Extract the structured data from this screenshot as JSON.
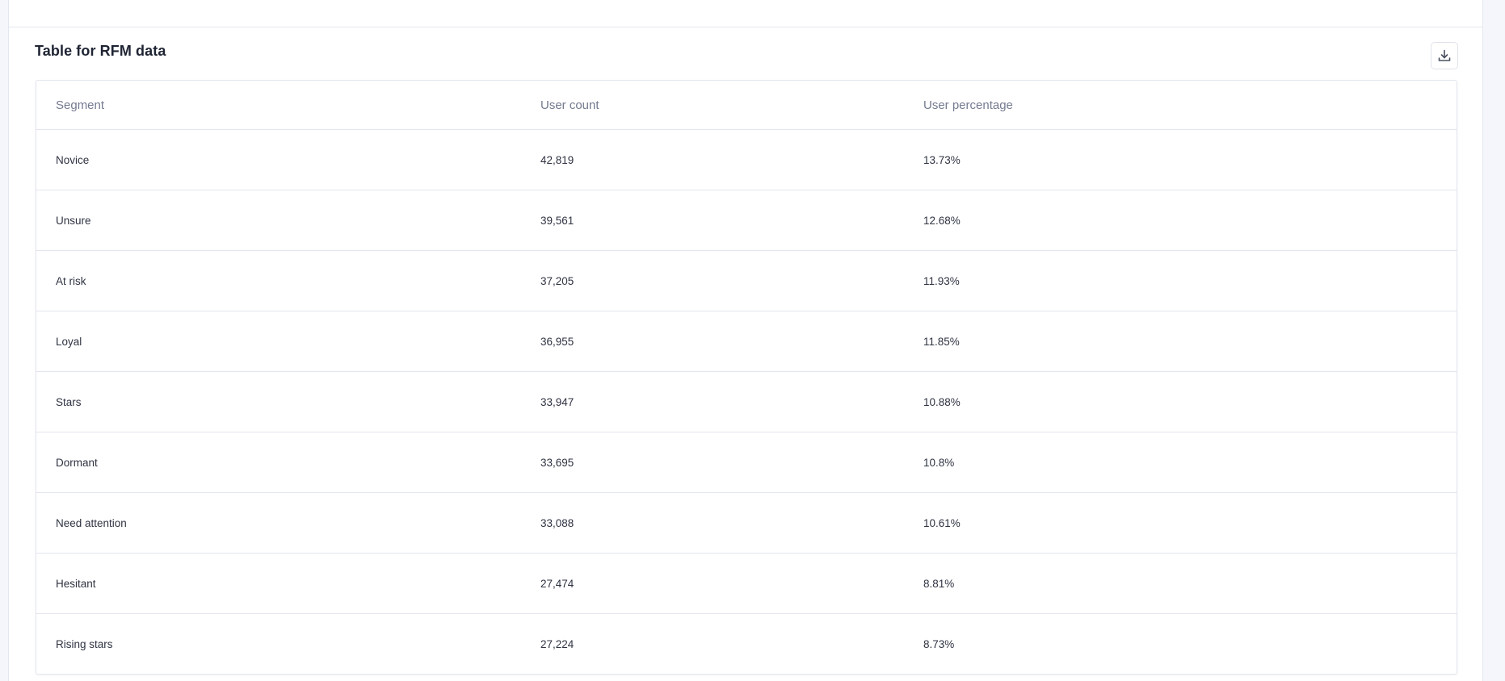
{
  "card": {
    "title": "Table for RFM data",
    "download_icon": "download-icon"
  },
  "table": {
    "headers": [
      "Segment",
      "User count",
      "User percentage"
    ],
    "rows": [
      {
        "segment": "Novice",
        "count": "42,819",
        "percent": "13.73%"
      },
      {
        "segment": "Unsure",
        "count": "39,561",
        "percent": "12.68%"
      },
      {
        "segment": "At risk",
        "count": "37,205",
        "percent": "11.93%"
      },
      {
        "segment": "Loyal",
        "count": "36,955",
        "percent": "11.85%"
      },
      {
        "segment": "Stars",
        "count": "33,947",
        "percent": "10.88%"
      },
      {
        "segment": "Dormant",
        "count": "33,695",
        "percent": "10.8%"
      },
      {
        "segment": "Need attention",
        "count": "33,088",
        "percent": "10.61%"
      },
      {
        "segment": "Hesitant",
        "count": "27,474",
        "percent": "8.81%"
      },
      {
        "segment": "Rising stars",
        "count": "27,224",
        "percent": "8.73%"
      }
    ]
  },
  "colors": {
    "page_background": "#f4f6fb",
    "card_background": "#ffffff",
    "border": "#e2e6ee",
    "header_text": "#747b8f",
    "body_text": "#2f3342",
    "title_text": "#1f2433"
  }
}
